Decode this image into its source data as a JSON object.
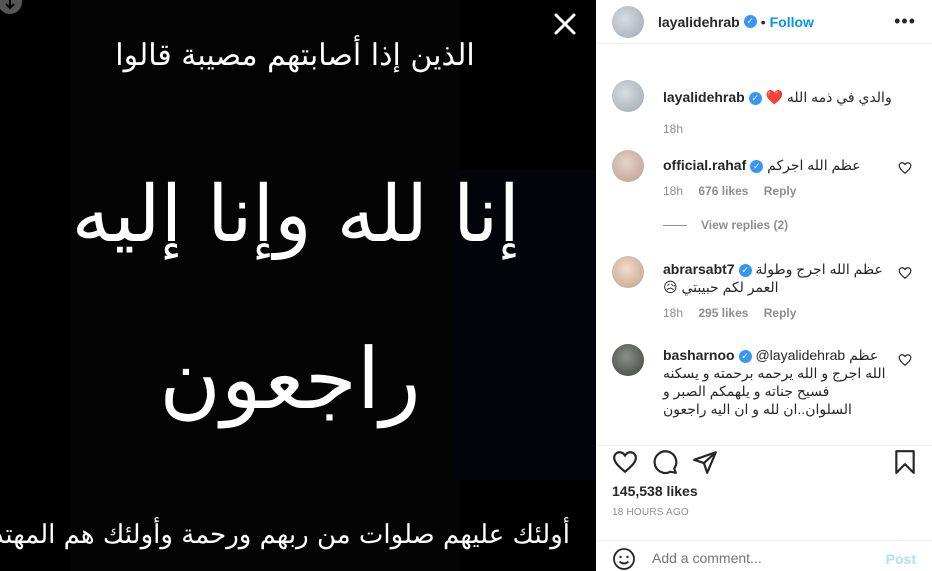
{
  "media": {
    "line_top": "الذين إذا أصابتهم مصيبة قالوا",
    "line_main1": "إنا لله وإنا إليه",
    "line_main2": "راجعون",
    "line_bottom": "أولئك عليهم صلوات من ربهم ورحمة وأولئك هم المهتدون"
  },
  "header": {
    "username": "layalidehrab",
    "dot": "•",
    "follow_label": "Follow",
    "more_label": "•••"
  },
  "caption": {
    "username": "layalidehrab",
    "text": "والدي في ذمه الله ❤️",
    "time": "18h"
  },
  "comments": [
    {
      "username": "official.rahaf",
      "text": "عظم الله اجركم",
      "time": "18h",
      "likes": "676 likes",
      "reply": "Reply",
      "view_replies": "View replies (2)"
    },
    {
      "username": "abrarsabt7",
      "text": "عظم الله اجرج وطولة العمر لكم حبيبتي 😥",
      "time": "18h",
      "likes": "295 likes",
      "reply": "Reply"
    },
    {
      "username": "basharnoo",
      "text": "@layalidehrab عظم الله اجرج و الله يرحمه برحمته و يسكنه فسيح جناته و يلهمكم الصبر و السلوان..ان لله و ان اليه راجعون"
    }
  ],
  "likes_count": "145,538 likes",
  "timestamp": "18 HOURS AGO",
  "add_comment": {
    "placeholder": "Add a comment...",
    "post_label": "Post"
  }
}
